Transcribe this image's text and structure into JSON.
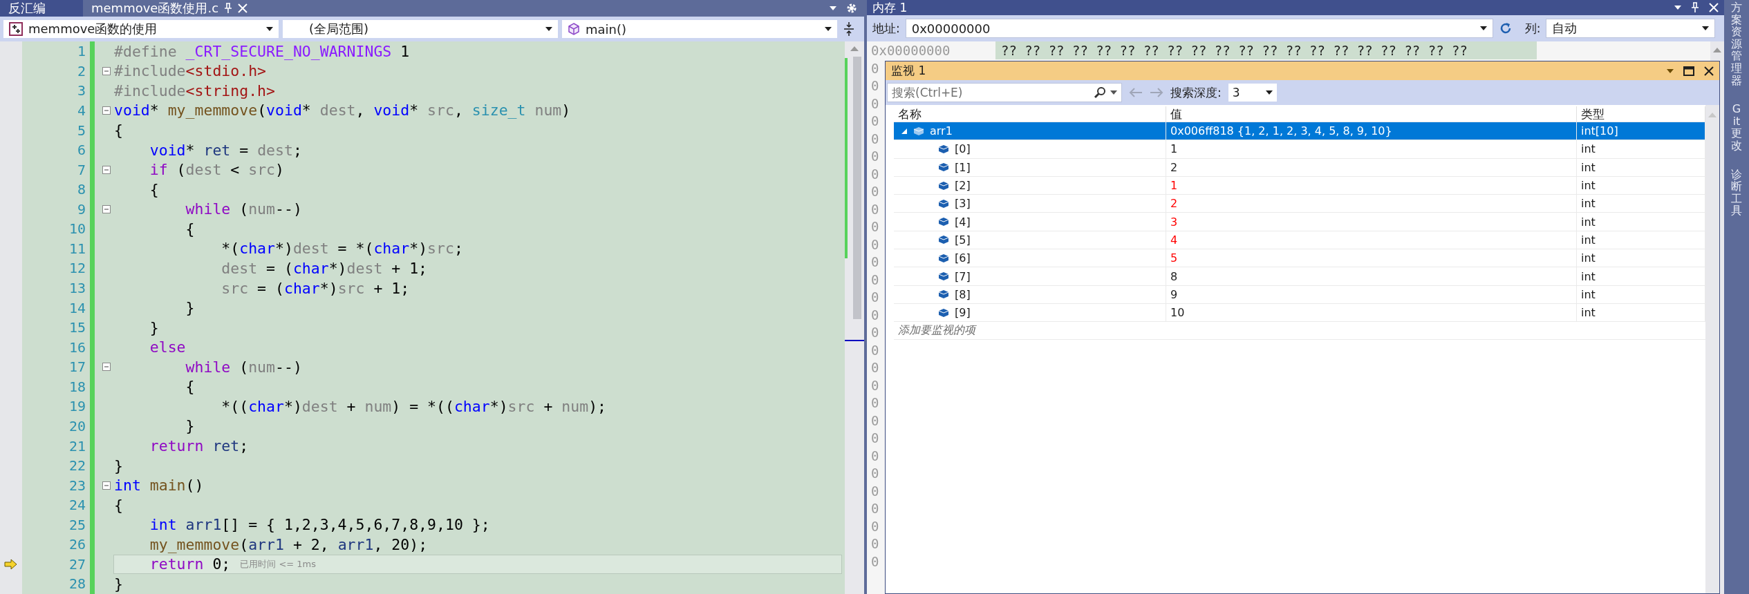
{
  "editor": {
    "tabs": [
      {
        "label": "反汇编",
        "selected": false
      },
      {
        "label": "memmove函数使用.c",
        "selected": true
      }
    ],
    "nav": [
      {
        "label": "memmove函数的使用",
        "kind": "project"
      },
      {
        "label": "(全局范围)",
        "kind": "scope"
      },
      {
        "label": "main()",
        "kind": "function"
      }
    ],
    "lines": [
      {
        "number": "1",
        "fold": false,
        "current": false,
        "tokens": [
          {
            "kind": "pp",
            "t": "#define "
          },
          {
            "kind": "macro",
            "t": "_CRT_SECURE_NO_WARNINGS"
          },
          {
            "kind": "p",
            "t": " 1"
          }
        ]
      },
      {
        "number": "2",
        "fold": true,
        "current": false,
        "tokens": [
          {
            "kind": "pp",
            "t": "#include"
          },
          {
            "kind": "str",
            "t": "<stdio.h>"
          }
        ]
      },
      {
        "number": "3",
        "fold": false,
        "current": false,
        "tokens": [
          {
            "kind": "pp",
            "t": "#include"
          },
          {
            "kind": "str",
            "t": "<string.h>"
          }
        ]
      },
      {
        "number": "4",
        "fold": true,
        "current": false,
        "tokens": [
          {
            "kind": "kw",
            "t": "void"
          },
          {
            "kind": "p",
            "t": "* "
          },
          {
            "kind": "fn",
            "t": "my_memmove"
          },
          {
            "kind": "p",
            "t": "("
          },
          {
            "kind": "kw",
            "t": "void"
          },
          {
            "kind": "p",
            "t": "* "
          },
          {
            "kind": "prm",
            "t": "dest"
          },
          {
            "kind": "p",
            "t": ", "
          },
          {
            "kind": "kw",
            "t": "void"
          },
          {
            "kind": "p",
            "t": "* "
          },
          {
            "kind": "prm",
            "t": "src"
          },
          {
            "kind": "p",
            "t": ", "
          },
          {
            "kind": "ty",
            "t": "size_t "
          },
          {
            "kind": "prm",
            "t": "num"
          },
          {
            "kind": "p",
            "t": ")"
          }
        ]
      },
      {
        "number": "5",
        "fold": false,
        "current": false,
        "tokens": [
          {
            "kind": "p",
            "t": "{"
          }
        ]
      },
      {
        "number": "6",
        "fold": false,
        "current": false,
        "tokens": [
          {
            "kind": "kw",
            "t": "    void"
          },
          {
            "kind": "p",
            "t": "* "
          },
          {
            "kind": "loc",
            "t": "ret"
          },
          {
            "kind": "p",
            "t": " = "
          },
          {
            "kind": "prm",
            "t": "dest"
          },
          {
            "kind": "p",
            "t": ";"
          }
        ]
      },
      {
        "number": "7",
        "fold": true,
        "current": false,
        "tokens": [
          {
            "kind": "ctl",
            "t": "    if"
          },
          {
            "kind": "p",
            "t": " ("
          },
          {
            "kind": "prm",
            "t": "dest"
          },
          {
            "kind": "p",
            "t": " < "
          },
          {
            "kind": "prm",
            "t": "src"
          },
          {
            "kind": "p",
            "t": ")"
          }
        ]
      },
      {
        "number": "8",
        "fold": false,
        "current": false,
        "tokens": [
          {
            "kind": "p",
            "t": "    {"
          }
        ]
      },
      {
        "number": "9",
        "fold": true,
        "current": false,
        "tokens": [
          {
            "kind": "ctl",
            "t": "        while"
          },
          {
            "kind": "p",
            "t": " ("
          },
          {
            "kind": "prm",
            "t": "num"
          },
          {
            "kind": "p",
            "t": "--)"
          }
        ]
      },
      {
        "number": "10",
        "fold": false,
        "current": false,
        "tokens": [
          {
            "kind": "p",
            "t": "        {"
          }
        ]
      },
      {
        "number": "11",
        "fold": false,
        "current": false,
        "tokens": [
          {
            "kind": "p",
            "t": "            *("
          },
          {
            "kind": "kw",
            "t": "char"
          },
          {
            "kind": "p",
            "t": "*)"
          },
          {
            "kind": "prm",
            "t": "dest"
          },
          {
            "kind": "p",
            "t": " = *("
          },
          {
            "kind": "kw",
            "t": "char"
          },
          {
            "kind": "p",
            "t": "*)"
          },
          {
            "kind": "prm",
            "t": "src"
          },
          {
            "kind": "p",
            "t": ";"
          }
        ]
      },
      {
        "number": "12",
        "fold": false,
        "current": false,
        "tokens": [
          {
            "kind": "prm",
            "t": "            dest"
          },
          {
            "kind": "p",
            "t": " = ("
          },
          {
            "kind": "kw",
            "t": "char"
          },
          {
            "kind": "p",
            "t": "*)"
          },
          {
            "kind": "prm",
            "t": "dest"
          },
          {
            "kind": "p",
            "t": " + 1;"
          }
        ]
      },
      {
        "number": "13",
        "fold": false,
        "current": false,
        "tokens": [
          {
            "kind": "prm",
            "t": "            src"
          },
          {
            "kind": "p",
            "t": " = ("
          },
          {
            "kind": "kw",
            "t": "char"
          },
          {
            "kind": "p",
            "t": "*)"
          },
          {
            "kind": "prm",
            "t": "src"
          },
          {
            "kind": "p",
            "t": " + 1;"
          }
        ]
      },
      {
        "number": "14",
        "fold": false,
        "current": false,
        "tokens": [
          {
            "kind": "p",
            "t": "        }"
          }
        ]
      },
      {
        "number": "15",
        "fold": false,
        "current": false,
        "tokens": [
          {
            "kind": "p",
            "t": "    }"
          }
        ]
      },
      {
        "number": "16",
        "fold": false,
        "current": false,
        "tokens": [
          {
            "kind": "ctl",
            "t": "    else"
          }
        ]
      },
      {
        "number": "17",
        "fold": true,
        "current": false,
        "tokens": [
          {
            "kind": "ctl",
            "t": "        while"
          },
          {
            "kind": "p",
            "t": " ("
          },
          {
            "kind": "prm",
            "t": "num"
          },
          {
            "kind": "p",
            "t": "--)"
          }
        ]
      },
      {
        "number": "18",
        "fold": false,
        "current": false,
        "tokens": [
          {
            "kind": "p",
            "t": "        {"
          }
        ]
      },
      {
        "number": "19",
        "fold": false,
        "current": false,
        "tokens": [
          {
            "kind": "p",
            "t": "            *(("
          },
          {
            "kind": "kw",
            "t": "char"
          },
          {
            "kind": "p",
            "t": "*)"
          },
          {
            "kind": "prm",
            "t": "dest"
          },
          {
            "kind": "p",
            "t": " + "
          },
          {
            "kind": "prm",
            "t": "num"
          },
          {
            "kind": "p",
            "t": ") = *(("
          },
          {
            "kind": "kw",
            "t": "char"
          },
          {
            "kind": "p",
            "t": "*)"
          },
          {
            "kind": "prm",
            "t": "src"
          },
          {
            "kind": "p",
            "t": " + "
          },
          {
            "kind": "prm",
            "t": "num"
          },
          {
            "kind": "p",
            "t": ");"
          }
        ]
      },
      {
        "number": "20",
        "fold": false,
        "current": false,
        "tokens": [
          {
            "kind": "p",
            "t": "        }"
          }
        ]
      },
      {
        "number": "21",
        "fold": false,
        "current": false,
        "tokens": [
          {
            "kind": "ctl",
            "t": "    return "
          },
          {
            "kind": "loc",
            "t": "ret"
          },
          {
            "kind": "p",
            "t": ";"
          }
        ]
      },
      {
        "number": "22",
        "fold": false,
        "current": false,
        "tokens": [
          {
            "kind": "p",
            "t": "}"
          }
        ]
      },
      {
        "number": "23",
        "fold": true,
        "current": false,
        "tokens": [
          {
            "kind": "kw",
            "t": "int "
          },
          {
            "kind": "fn",
            "t": "main"
          },
          {
            "kind": "p",
            "t": "()"
          }
        ]
      },
      {
        "number": "24",
        "fold": false,
        "current": false,
        "tokens": [
          {
            "kind": "p",
            "t": "{"
          }
        ]
      },
      {
        "number": "25",
        "fold": false,
        "current": false,
        "tokens": [
          {
            "kind": "kw",
            "t": "    int "
          },
          {
            "kind": "loc",
            "t": "arr1"
          },
          {
            "kind": "p",
            "t": "[] = { 1,2,3,4,5,6,7,8,9,10 };"
          }
        ]
      },
      {
        "number": "26",
        "fold": false,
        "current": false,
        "tokens": [
          {
            "kind": "fn",
            "t": "    my_memmove"
          },
          {
            "kind": "p",
            "t": "("
          },
          {
            "kind": "loc",
            "t": "arr1"
          },
          {
            "kind": "p",
            "t": " + 2, "
          },
          {
            "kind": "loc",
            "t": "arr1"
          },
          {
            "kind": "p",
            "t": ", 20);"
          }
        ]
      },
      {
        "number": "27",
        "fold": false,
        "current": true,
        "hint": "已用时间 <= 1ms",
        "tokens": [
          {
            "kind": "ctl",
            "t": "    return"
          },
          {
            "kind": "p",
            "t": " 0;"
          }
        ]
      },
      {
        "number": "28",
        "fold": false,
        "current": false,
        "tokens": [
          {
            "kind": "p",
            "t": "}"
          }
        ]
      }
    ]
  },
  "memory": {
    "title": "内存 1",
    "address_label": "地址:",
    "address": "0x00000000",
    "columns_label": "列:",
    "columns": "自动",
    "first_row": {
      "address": "0x00000000",
      "bytes": "?? ?? ?? ?? ?? ?? ?? ?? ?? ?? ?? ?? ?? ?? ?? ?? ?? ?? ?? ??"
    },
    "hidden_rows": [
      "0",
      "0",
      "0",
      "0",
      "0",
      "0",
      "0",
      "0",
      "0",
      "0",
      "0",
      "0",
      "0",
      "0",
      "0",
      "0",
      "0",
      "0",
      "0",
      "0",
      "0",
      "0",
      "0",
      "0",
      "0",
      "0",
      "0",
      "0",
      "0"
    ]
  },
  "watch": {
    "title": "监视 1",
    "search_placeholder": "搜索(Ctrl+E)",
    "depth_label": "搜索深度:",
    "depth": "3",
    "columns": [
      "名称",
      "值",
      "类型"
    ],
    "rows": [
      {
        "name": "arr1",
        "value": "0x006ff818 {1, 2, 1, 2, 3, 4, 5, 8, 9, 10}",
        "type": "int[10]",
        "selected": true,
        "expanded": true,
        "children": [
          {
            "name": "[0]",
            "value": "1",
            "type": "int",
            "selected": false,
            "changed": false
          },
          {
            "name": "[1]",
            "value": "2",
            "type": "int",
            "selected": false,
            "changed": false
          },
          {
            "name": "[2]",
            "value": "1",
            "type": "int",
            "selected": false,
            "changed": true
          },
          {
            "name": "[3]",
            "value": "2",
            "type": "int",
            "selected": false,
            "changed": true
          },
          {
            "name": "[4]",
            "value": "3",
            "type": "int",
            "selected": false,
            "changed": true
          },
          {
            "name": "[5]",
            "value": "4",
            "type": "int",
            "selected": false,
            "changed": true
          },
          {
            "name": "[6]",
            "value": "5",
            "type": "int",
            "selected": false,
            "changed": true
          },
          {
            "name": "[7]",
            "value": "8",
            "type": "int",
            "selected": false,
            "changed": false
          },
          {
            "name": "[8]",
            "value": "9",
            "type": "int",
            "selected": false,
            "changed": false
          },
          {
            "name": "[9]",
            "value": "10",
            "type": "int",
            "selected": false,
            "changed": false
          }
        ]
      }
    ],
    "add_placeholder": "添加要监视的项"
  },
  "side_tabs": [
    "方案资源管理器",
    "Git 更改",
    "诊断工具"
  ]
}
